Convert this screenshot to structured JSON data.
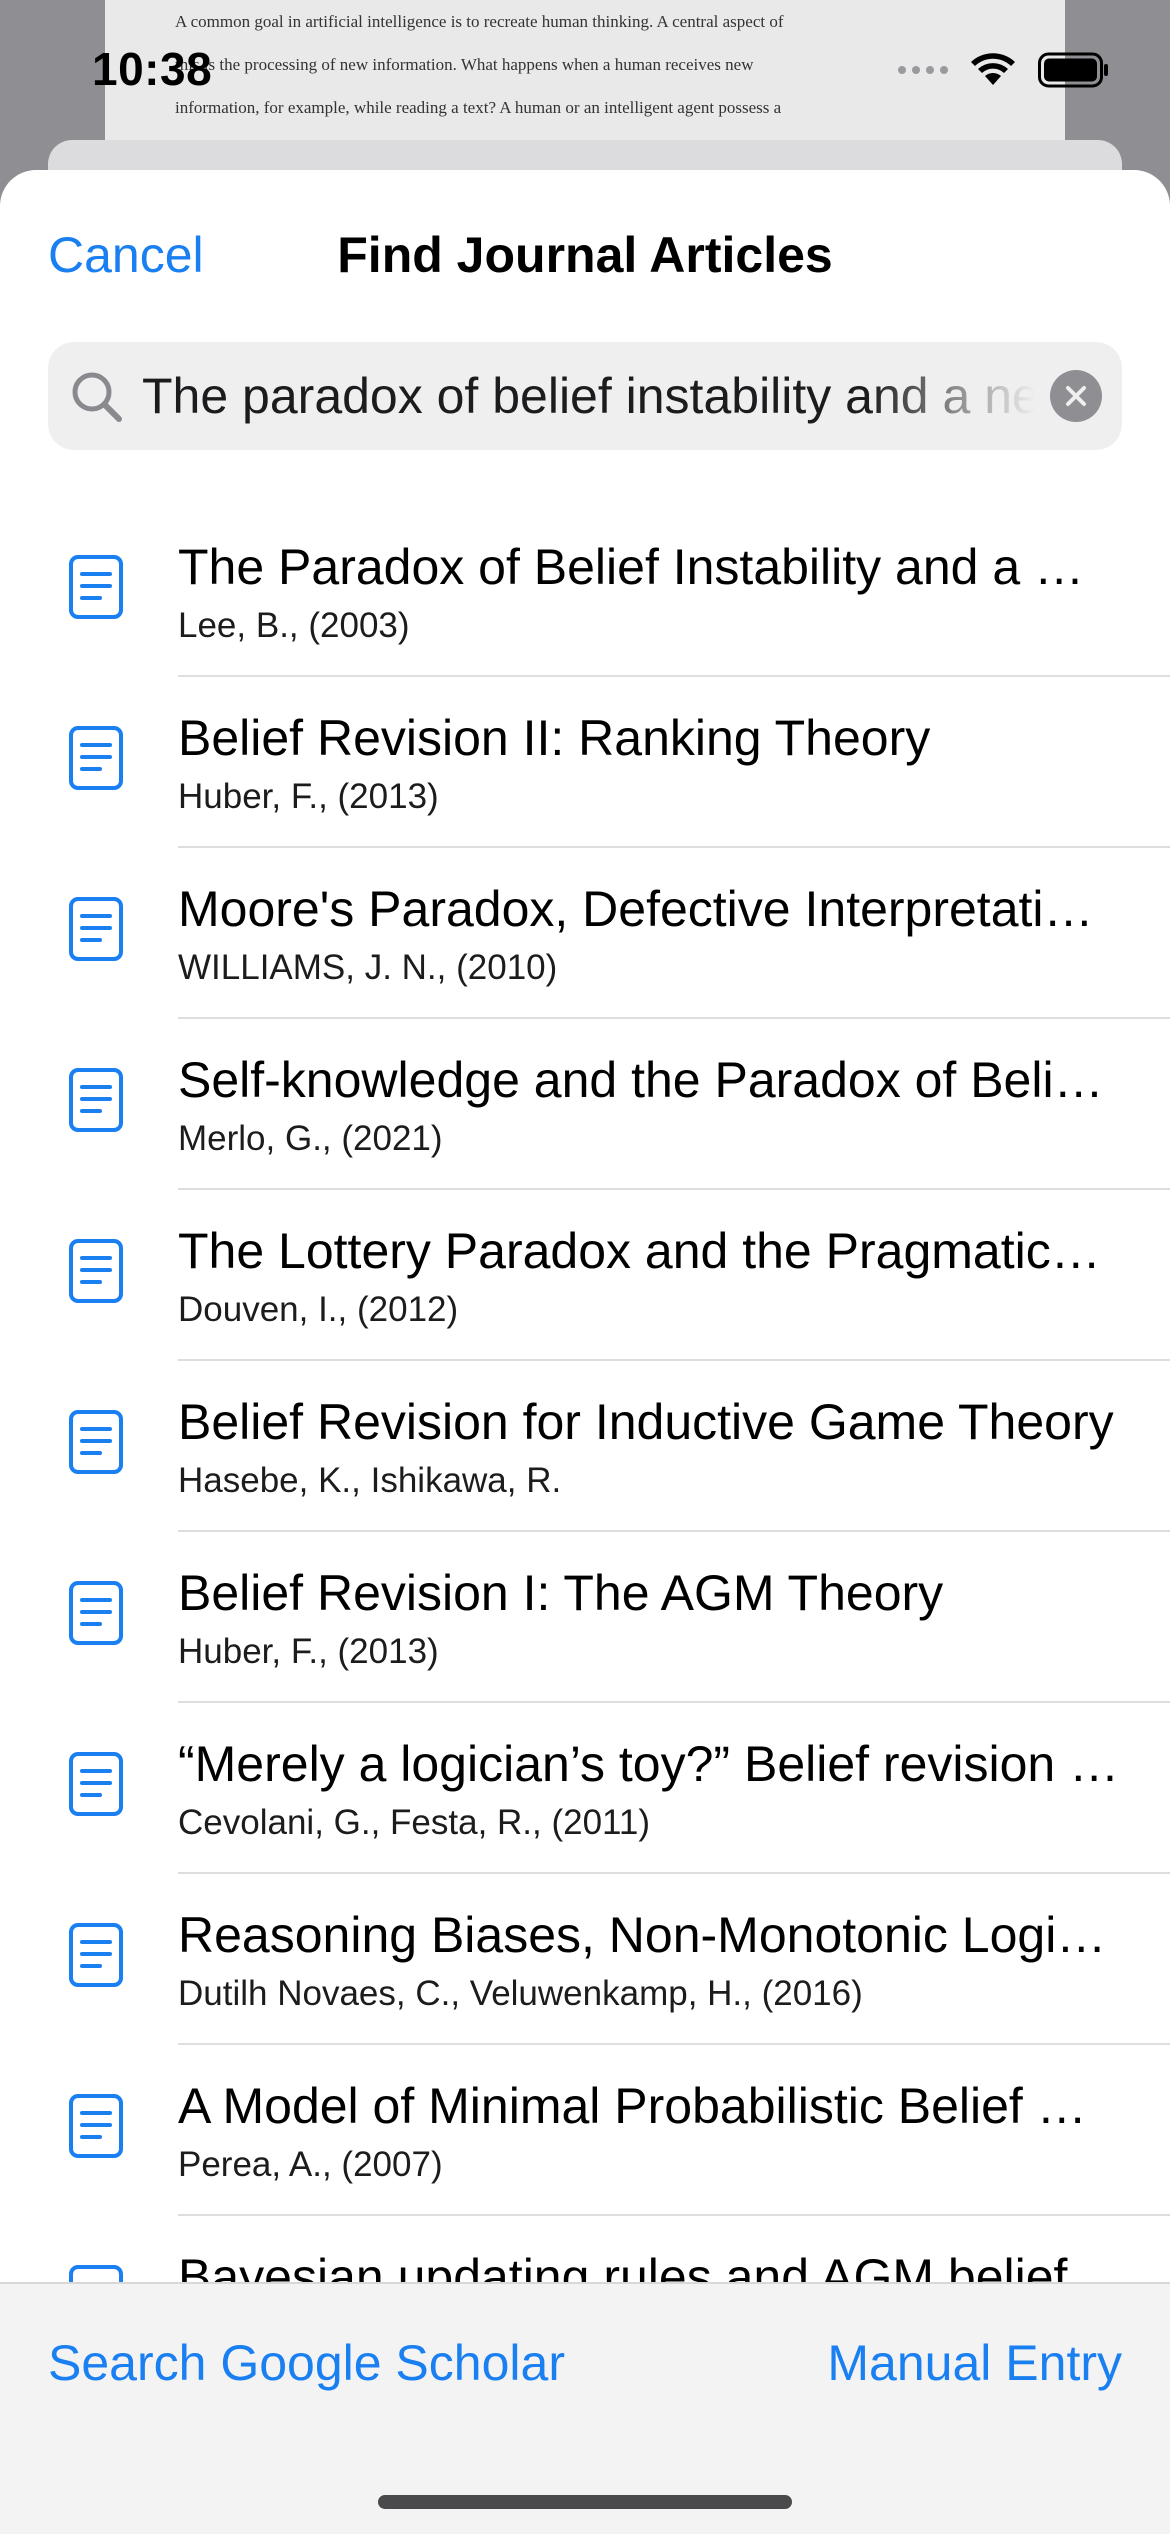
{
  "background_document": {
    "lines": [
      "A common goal in artificial intelligence is to recreate human thinking. A central aspect of",
      "this is the processing of new information. What happens when a human receives new",
      "information, for example, while reading a text? A human or an intelligent agent possess a"
    ]
  },
  "status_bar": {
    "time": "10:38",
    "icons": [
      "cellular-signal-icon",
      "wifi-icon",
      "battery-icon"
    ]
  },
  "sheet": {
    "cancel_label": "Cancel",
    "title": "Find Journal Articles"
  },
  "search": {
    "value": "The paradox of belief instability and a new"
  },
  "results": [
    {
      "title": "The Paradox of Belief Instability and a New Dynamic Belief Revision",
      "subtitle": "Lee, B., (2003)"
    },
    {
      "title": "Belief Revision II: Ranking Theory",
      "subtitle": "Huber, F., (2013)"
    },
    {
      "title": "Moore's Paradox, Defective Interpretation, and Belief",
      "subtitle": "WILLIAMS, J. N., (2010)"
    },
    {
      "title": "Self-knowledge and the Paradox of Belief Revision",
      "subtitle": "Merlo, G., (2021)"
    },
    {
      "title": "The Lottery Paradox and the Pragmatics of Belief",
      "subtitle": "Douven, I., (2012)"
    },
    {
      "title": "Belief Revision for Inductive Game Theory",
      "subtitle": "Hasebe, K., Ishikawa, R."
    },
    {
      "title": "Belief Revision I: The AGM Theory",
      "subtitle": "Huber, F., (2013)"
    },
    {
      "title": "“Merely a logician’s toy?” Belief revision confronts scientific theory change",
      "subtitle": "Cevolani, G., Festa, R., (2011)"
    },
    {
      "title": "Reasoning Biases, Non-Monotonic Logics and Belief Revision",
      "subtitle": "Dutilh Novaes, C., Veluwenkamp, H., (2016)"
    },
    {
      "title": "A Model of Minimal Probabilistic Belief Revision",
      "subtitle": "Perea, A., (2007)"
    },
    {
      "title": "Bayesian updating rules and AGM belief revision",
      "subtitle": ""
    }
  ],
  "bottom_bar": {
    "left_label": "Search Google Scholar",
    "right_label": "Manual Entry"
  },
  "colors": {
    "accent": "#1a7ff0",
    "separator": "#dedee0",
    "search_bg": "#efeff0"
  }
}
